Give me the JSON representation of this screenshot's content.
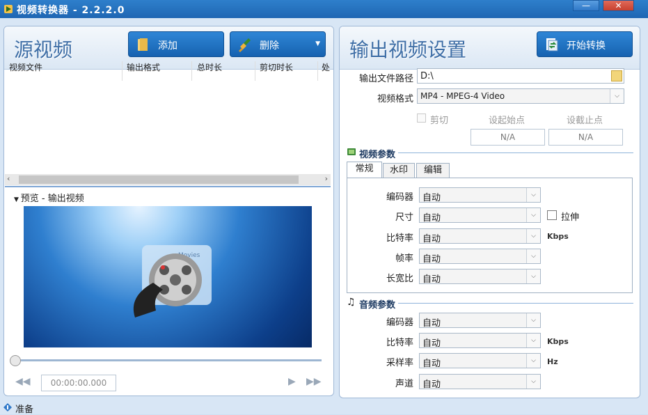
{
  "window": {
    "title": "视频转换器 - 2.2.2.0",
    "minimize": "—",
    "close": "✕"
  },
  "source": {
    "title": "源视频",
    "add_button": "添加",
    "delete_button": "删除",
    "columns": [
      "视频文件",
      "输出格式",
      "总时长",
      "剪切时长",
      "处"
    ],
    "preview_label": "预览 - 输出视频",
    "preview_caption": "Movies",
    "time_display": "00:00:00.000"
  },
  "output": {
    "title": "输出视频设置",
    "start_button": "开始转换",
    "path_label": "输出文件路径",
    "path_value": "D:\\",
    "format_label": "视频格式",
    "format_value": "MP4 - MPEG-4 Video",
    "cut_label": "剪切",
    "start_point_label": "设起始点",
    "end_point_label": "设截止点",
    "start_point_value": "N/A",
    "end_point_value": "N/A"
  },
  "video_params": {
    "heading": "视频参数",
    "tabs": [
      "常规",
      "水印",
      "编辑"
    ],
    "fields": [
      {
        "label": "编码器",
        "value": "自动"
      },
      {
        "label": "尺寸",
        "value": "自动"
      },
      {
        "label": "比特率",
        "value": "自动"
      },
      {
        "label": "帧率",
        "value": "自动"
      },
      {
        "label": "长宽比",
        "value": "自动"
      }
    ],
    "stretch_label": "拉伸",
    "bitrate_unit": "Kbps"
  },
  "audio_params": {
    "heading": "音频参数",
    "fields": [
      {
        "label": "编码器",
        "value": "自动"
      },
      {
        "label": "比特率",
        "value": "自动"
      },
      {
        "label": "采样率",
        "value": "自动"
      },
      {
        "label": "声道",
        "value": "自动"
      }
    ],
    "bitrate_unit": "Kbps",
    "samplerate_unit": "Hz"
  },
  "status": {
    "text": "准备"
  },
  "icons": {
    "add": "folder-icon",
    "delete": "broom-icon",
    "start": "convert-icon",
    "video_section": "film-icon",
    "audio_section": "music-note-icon"
  }
}
